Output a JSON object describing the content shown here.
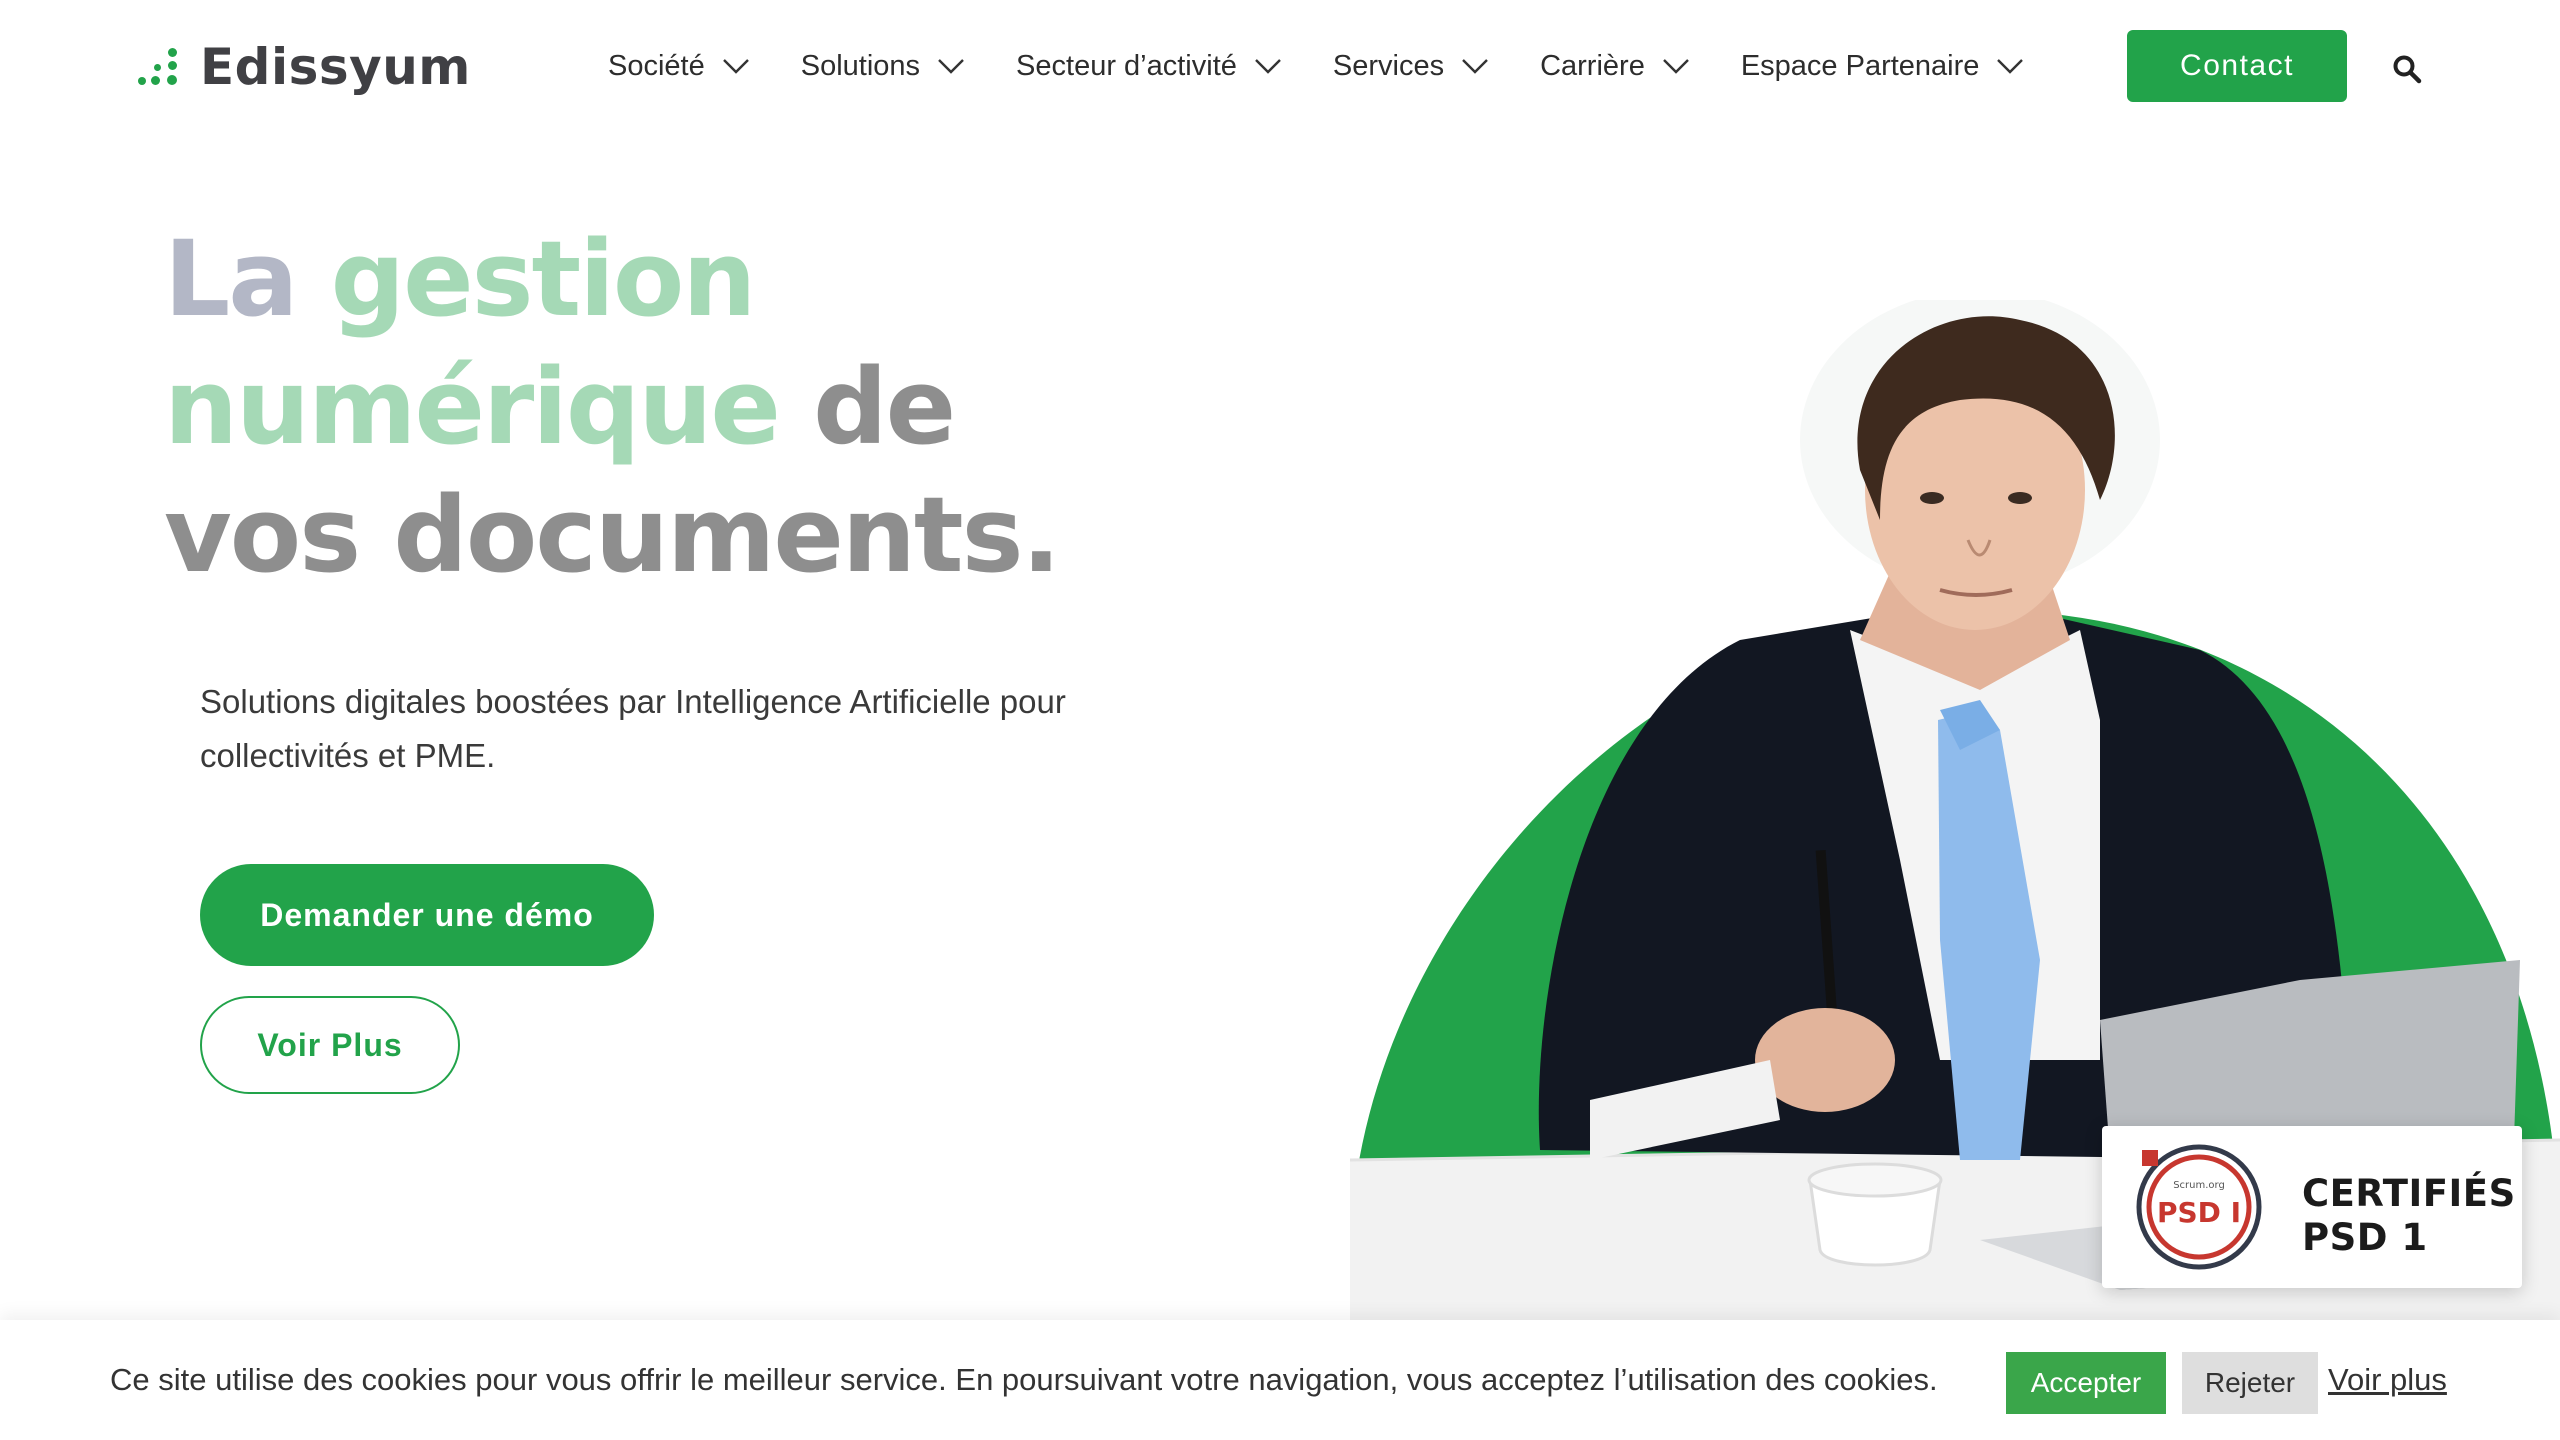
{
  "brand": {
    "name": "Edissyum",
    "accent": "#22a34a"
  },
  "nav": {
    "items": [
      {
        "label": "Société"
      },
      {
        "label": "Solutions"
      },
      {
        "label": "Secteur d’activité"
      },
      {
        "label": "Services"
      },
      {
        "label": "Carrière"
      },
      {
        "label": "Espace Partenaire"
      }
    ],
    "contact_label": "Contact",
    "search_icon": "search-icon"
  },
  "hero": {
    "title_la": "La",
    "title_green": "gestion numérique",
    "title_rest_1": "de vos",
    "title_rest_2": "documents.",
    "subtitle": "Solutions digitales boostées par Intelligence Artificielle pour collectivités et PME.",
    "demo_label": "Demander une démo",
    "more_label": "Voir Plus"
  },
  "certification": {
    "badge_text": "PSD I",
    "badge_org": "Scrum.org",
    "line1": "CERTIFIÉS",
    "line2": "PSD 1"
  },
  "cookie": {
    "text": "Ce site utilise des cookies pour vous offrir le meilleur service. En poursuivant votre navigation, vous acceptez l’utilisation des cookies.",
    "accept_label": "Accepter",
    "reject_label": "Rejeter",
    "more_label": "Voir plus"
  }
}
